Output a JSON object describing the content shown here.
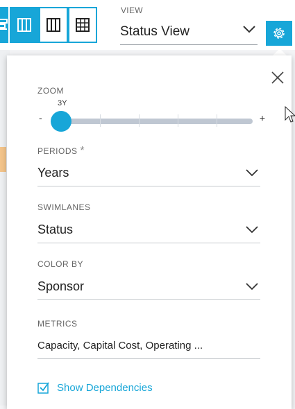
{
  "view": {
    "label": "VIEW",
    "selected": "Status View"
  },
  "zoom": {
    "label": "ZOOM",
    "value": "3Y",
    "min_symbol": "-",
    "max_symbol": "+",
    "level": 0
  },
  "periods": {
    "label": "PERIODS",
    "required_marker": "*",
    "selected": "Years"
  },
  "swimlanes": {
    "label": "SWIMLANES",
    "selected": "Status"
  },
  "color_by": {
    "label": "COLOR BY",
    "selected": "Sponsor"
  },
  "metrics": {
    "label": "METRICS",
    "value": "Capacity, Capital Cost, Operating ..."
  },
  "dependencies": {
    "label": "Show Dependencies",
    "checked": true
  },
  "colors": {
    "accent": "#17a6d8"
  }
}
